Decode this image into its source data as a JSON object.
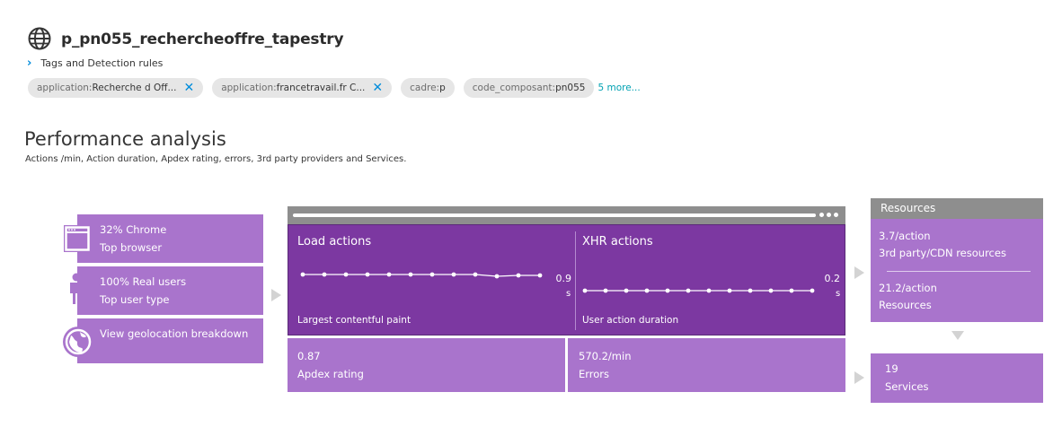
{
  "header": {
    "icon": "globe-icon",
    "title": "p_pn055_rechercheoffre_tapestry",
    "tags_toggle_label": "Tags and Detection rules"
  },
  "tags": [
    {
      "key": "application: ",
      "value": "Recherche d Off...",
      "removable": true
    },
    {
      "key": "application: ",
      "value": "francetravail.fr C...",
      "removable": true
    },
    {
      "key": "cadre: ",
      "value": "p",
      "removable": false
    },
    {
      "key": "code_composant: ",
      "value": "pn055",
      "removable": false
    }
  ],
  "more_tags_label": "5 more...",
  "performance": {
    "title": "Performance analysis",
    "subtitle": "Actions /min, Action duration, Apdex rating, errors, 3rd party providers and Services."
  },
  "left_cards": {
    "browser": {
      "line1": "32% Chrome",
      "line2": "Top browser",
      "icon": "browser-window-icon"
    },
    "users": {
      "line1": "100% Real users",
      "line2": "Top user type",
      "icon": "person-icon"
    },
    "geo": {
      "line1": "View geolocation breakdown",
      "icon": "globe-icon"
    }
  },
  "load_actions": {
    "title": "Load actions",
    "value": "0.9",
    "unit": "s",
    "footer": "Largest contentful paint"
  },
  "xhr_actions": {
    "title": "XHR actions",
    "value": "0.2",
    "unit": "s",
    "footer": "User action duration"
  },
  "apdex": {
    "value": "0.87",
    "label": "Apdex rating"
  },
  "errors": {
    "value": "570.2/min",
    "label": "Errors"
  },
  "resources": {
    "header": "Resources",
    "third_party_value": "3.7/action",
    "third_party_label": "3rd party/CDN resources",
    "resources_value": "21.2/action",
    "resources_label": "Resources"
  },
  "services": {
    "value": "19",
    "label": "Services"
  },
  "colors": {
    "accent_purple": "#a974cc",
    "dark_purple": "#7c38a1",
    "link_blue": "#008cdb",
    "frame_gray": "#8e8e8e"
  }
}
